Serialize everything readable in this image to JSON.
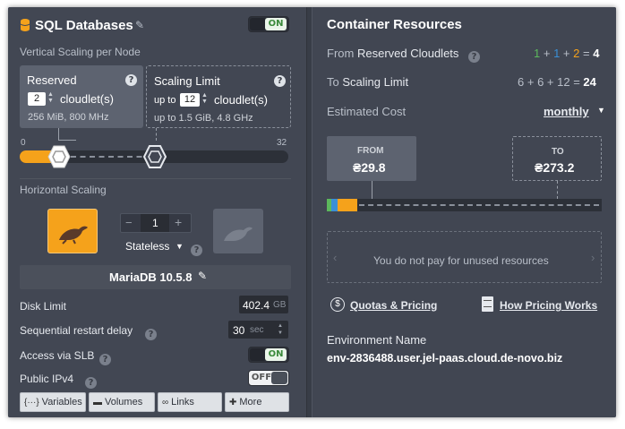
{
  "left": {
    "title": "SQL Databases",
    "title_toggle": "ON",
    "vertical_scaling_label": "Vertical Scaling per Node",
    "reserved": {
      "title": "Reserved",
      "value": "2",
      "unit": "cloudlet(s)",
      "detail": "256 MiB, 800 MHz"
    },
    "scaling_limit": {
      "title": "Scaling Limit",
      "prefix": "up to",
      "value": "12",
      "unit": "cloudlet(s)",
      "detail": "up to 1.5 GiB, 4.8 GHz"
    },
    "slider": {
      "min_label": "0",
      "max_label": "32",
      "min": 0,
      "max": 32,
      "reserved": 2,
      "limit": 12
    },
    "horizontal_scaling_label": "Horizontal Scaling",
    "node_count": "1",
    "minus": "−",
    "plus": "+",
    "mode": "Stateless",
    "node_name": "MariaDB 10.5.8",
    "disk_limit": {
      "label": "Disk Limit",
      "value": "402.4",
      "unit": "GB"
    },
    "restart_delay": {
      "label": "Sequential restart delay",
      "value": "30",
      "unit": "sec"
    },
    "slb": {
      "label": "Access via SLB",
      "toggle": "ON"
    },
    "ipv4": {
      "label": "Public IPv4",
      "toggle": "OFF"
    },
    "buttons": {
      "variables": "Variables",
      "volumes": "Volumes",
      "links": "Links",
      "more": "More"
    }
  },
  "right": {
    "title": "Container Resources",
    "from_reserved": {
      "label_pre": "From",
      "label": "Reserved Cloudlets",
      "a": "1",
      "b": "1",
      "c": "2",
      "total": "4"
    },
    "to_limit": {
      "label_pre": "To",
      "label": "Scaling Limit",
      "a": "6",
      "b": "6",
      "c": "12",
      "total": "24"
    },
    "estimated_cost": {
      "label": "Estimated Cost",
      "period": "monthly"
    },
    "from_box": {
      "title": "FROM",
      "value": "₴29.8"
    },
    "to_box": {
      "title": "TO",
      "value": "₴273.2"
    },
    "unused_note": "You do not pay for unused resources",
    "quotas_link": "Quotas & Pricing",
    "pricing_link": "How Pricing Works",
    "env_label": "Environment Name",
    "env_value": "env-2836488.user.jel-paas.cloud.de-novo.biz"
  },
  "colors": {
    "accent_orange": "#f5a21b",
    "green": "#5cb85c",
    "blue": "#3a8fd6"
  }
}
